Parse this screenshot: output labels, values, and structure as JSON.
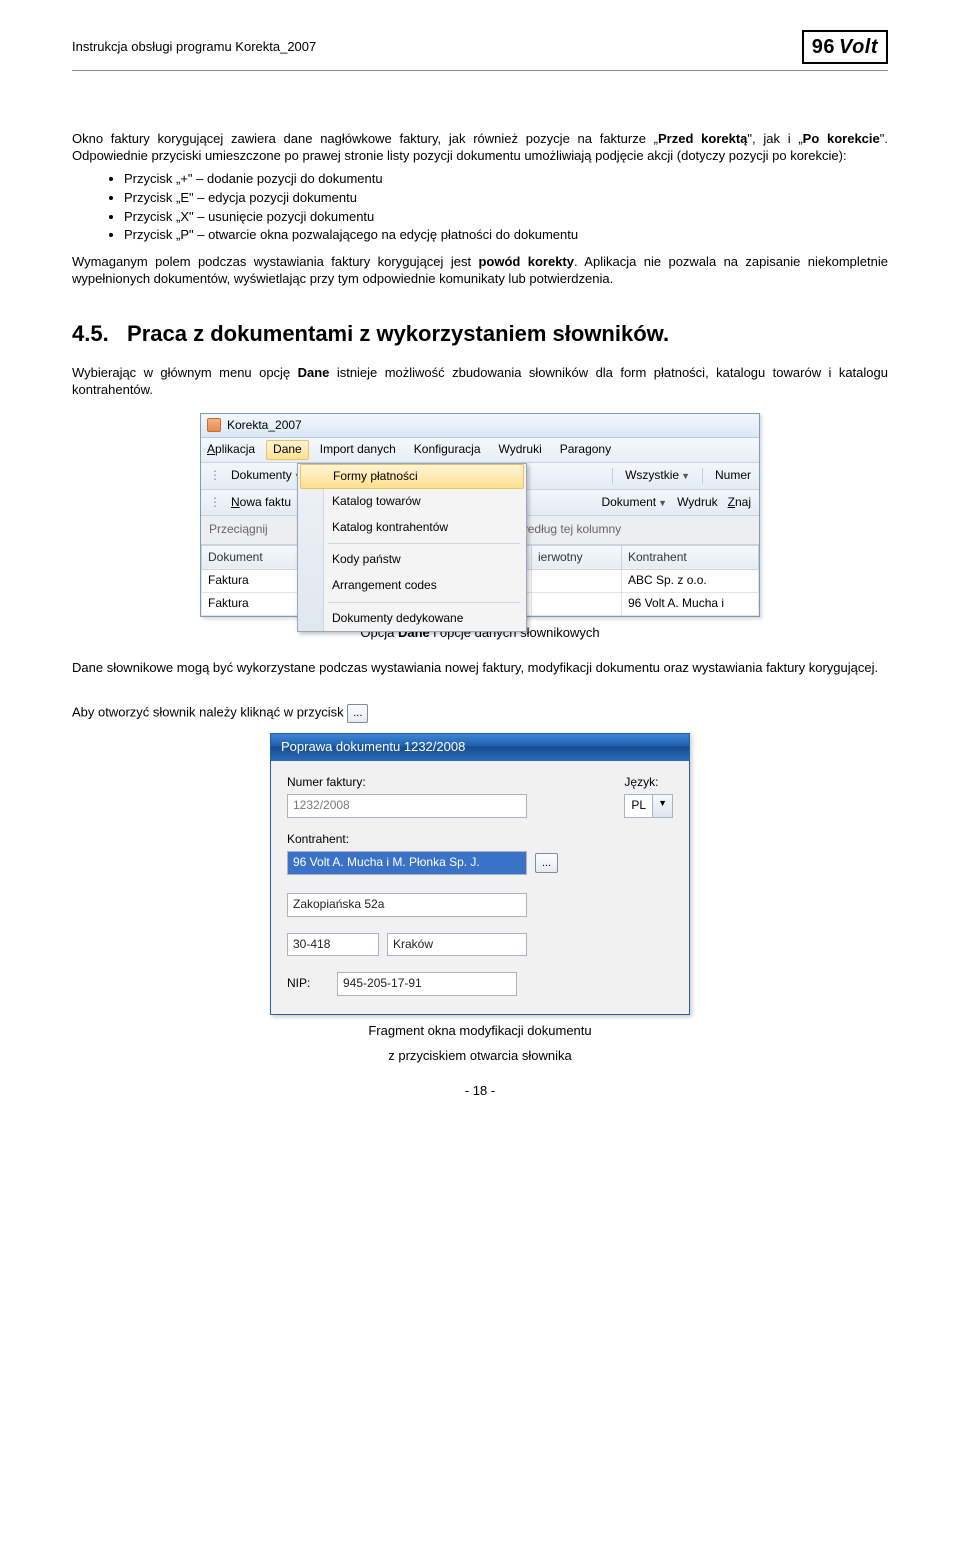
{
  "header": {
    "title": "Instrukcja obsługi programu Korekta_2007",
    "logo_num": "96",
    "logo_text": "Volt"
  },
  "para1": "Okno faktury korygującej zawiera dane nagłówkowe faktury, jak również pozycje na fakturze „Przed korektą\", jak i „Po korekcie\". Odpowiednie przyciski umieszczone po prawej stronie listy pozycji dokumentu umożliwiają podjęcie akcji (dotyczy pozycji po korekcie):",
  "bullets": [
    "Przycisk „+\" – dodanie pozycji do dokumentu",
    "Przycisk „E\" – edycja pozycji dokumentu",
    "Przycisk „X\" – usunięcie pozycji dokumentu",
    "Przycisk „P\" – otwarcie okna pozwalającego na edycję płatności do dokumentu"
  ],
  "para2": "Wymaganym polem podczas wystawiania faktury korygującej jest powód korekty. Aplikacja nie pozwala na zapisanie niekompletnie wypełnionych dokumentów, wyświetlając przy tym odpowiednie komunikaty lub potwierdzenia.",
  "section": {
    "number": "4.5.",
    "title": "Praca z dokumentami z wykorzystaniem słowników."
  },
  "para3": "Wybierając w głównym menu opcję Dane istnieje możliwość zbudowania słowników dla form płatności, katalogu towarów i katalogu kontrahentów.",
  "app": {
    "title": "Korekta_2007",
    "menu": [
      "Aplikacja",
      "Dane",
      "Import danych",
      "Konfiguracja",
      "Wydruki",
      "Paragony"
    ],
    "toolbar1": {
      "dokumenty": "Dokumenty",
      "wszystkie": "Wszystkie",
      "numer": "Numer"
    },
    "dropdown": [
      "Formy płatności",
      "Katalog towarów",
      "Katalog kontrahentów",
      "Kody państw",
      "Arrangement codes",
      "Dokumenty dedykowane"
    ],
    "toolbar2": {
      "nowa": "Nowa faktu",
      "dokument": "Dokument",
      "wydruk": "Wydruk",
      "znaj": "Znaj"
    },
    "groupbar": "Przeciągnij",
    "groupbar_after": "ne według tej kolumny",
    "grid": {
      "headers": [
        "Dokument",
        "ierwotny",
        "Kontrahent"
      ],
      "rows": [
        [
          "Faktura",
          "",
          "ABC Sp. z o.o."
        ],
        [
          "Faktura",
          "",
          "96 Volt A. Mucha i"
        ]
      ]
    }
  },
  "caption1": "Opcja Dane i opcje danych słownikowych",
  "para4": "Dane słownikowe mogą być wykorzystane podczas wystawiania nowej faktury, modyfikacji dokumentu oraz wystawiania faktury korygującej.",
  "para5_before": "Aby otworzyć słownik należy kliknąć w przycisk ",
  "ellipsis": "...",
  "dialog": {
    "title": "Poprawa dokumentu 1232/2008",
    "labels": {
      "numer": "Numer faktury:",
      "jezyk": "Język:",
      "kontrahent": "Kontrahent:",
      "nip": "NIP:"
    },
    "values": {
      "numer": "1232/2008",
      "jezyk": "PL",
      "kontrahent": "96 Volt A. Mucha i M. Płonka Sp. J.",
      "ulica": "Zakopiańska 52a",
      "kod": "30-418",
      "miasto": "Kraków",
      "nip": "945-205-17-91"
    }
  },
  "caption2a": "Fragment okna modyfikacji dokumentu",
  "caption2b": "z przyciskiem otwarcia słownika",
  "pagenum": "- 18 -"
}
